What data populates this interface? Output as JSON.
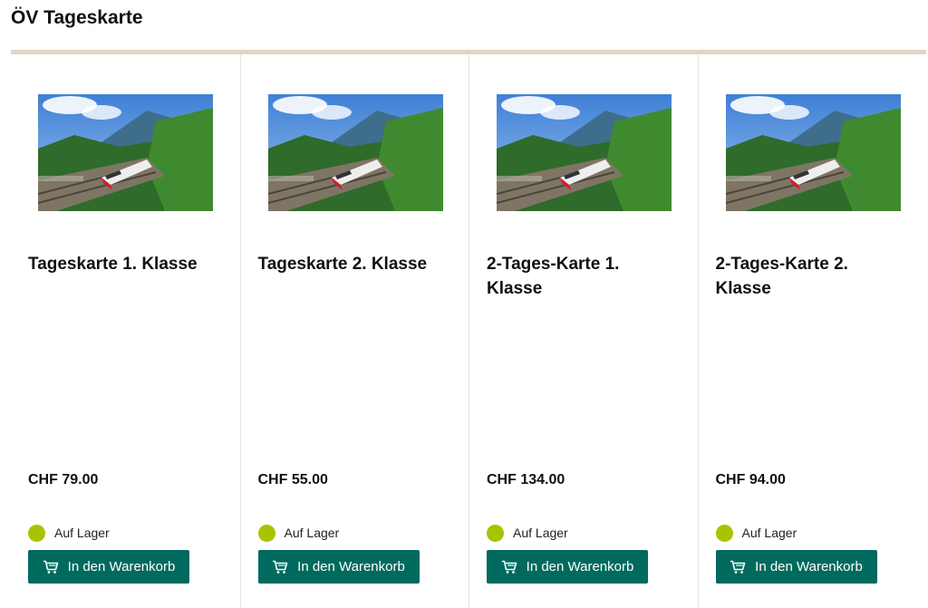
{
  "section": {
    "title": "ÖV Tageskarte"
  },
  "products": [
    {
      "title": "Tageskarte 1. Klasse",
      "price": "CHF 79.00",
      "stock": "Auf Lager",
      "button": "In den Warenkorb"
    },
    {
      "title": "Tageskarte 2. Klasse",
      "price": "CHF 55.00",
      "stock": "Auf Lager",
      "button": "In den Warenkorb"
    },
    {
      "title": "2-Tages-Karte 1. Klasse",
      "price": "CHF 134.00",
      "stock": "Auf Lager",
      "button": "In den Warenkorb"
    },
    {
      "title": "2-Tages-Karte 2. Klasse",
      "price": "CHF 94.00",
      "stock": "Auf Lager",
      "button": "In den Warenkorb"
    }
  ],
  "colors": {
    "accent": "#006a5e",
    "stock_indicator": "#a8c300",
    "divider": "#ddd6c2"
  },
  "icons": {
    "cart": "shopping-cart-icon",
    "stock": "in-stock-dot"
  }
}
